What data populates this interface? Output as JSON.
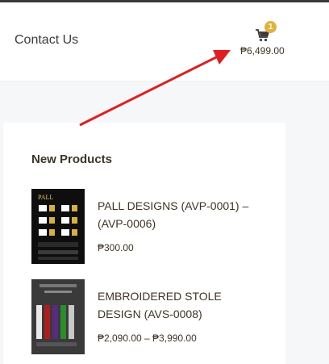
{
  "header": {
    "contact_label": "Contact Us",
    "cart": {
      "count": "1",
      "total": "₱6,499.00"
    }
  },
  "new_products": {
    "title": "New Products",
    "items": [
      {
        "name": "PALL DESIGNS (AVP-0001) – (AVP-0006)",
        "price": "₱300.00",
        "thumb_title": "PALL"
      },
      {
        "name": "EMBROIDERED STOLE DESIGN (AVS-0008)",
        "price": "₱2,090.00 – ₱3,990.00"
      }
    ]
  },
  "colors": {
    "accent": "#e2b33c",
    "text": "#3f3521",
    "arrow": "#e02020"
  },
  "icons": [
    "cart-icon"
  ]
}
